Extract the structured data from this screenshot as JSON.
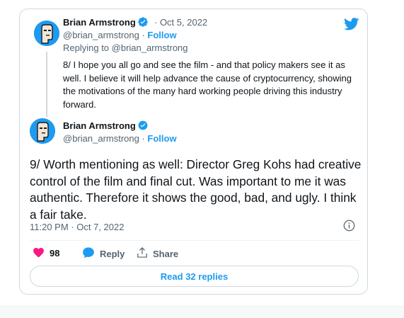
{
  "colors": {
    "accent": "#1d9bf0",
    "heart": "#f91880",
    "text": "#0f1419",
    "muted": "#536471"
  },
  "icons": [
    "twitter-bird-icon",
    "verified-badge-icon",
    "info-icon",
    "heart-icon",
    "reply-bubble-icon",
    "share-icon"
  ],
  "previous_tweet": {
    "author_name": "Brian Armstrong",
    "date": "· Oct 5, 2022",
    "handle": "@brian_armstrong",
    "separator": " · ",
    "follow_label": "Follow",
    "replying_to": "Replying to @brian_armstrong",
    "text": "8/ I hope you all go and see the film - and that policy makers see it as well. I believe it will help advance the cause of cryptocurrency, showing the motivations of the many hard working people driving this industry forward."
  },
  "main_tweet": {
    "author_name": "Brian Armstrong",
    "handle": "@brian_armstrong",
    "separator": " · ",
    "follow_label": "Follow",
    "text": "9/ Worth mentioning as well: Director Greg Kohs had creative control of the film and final cut. Was important to me it was authentic. Therefore it shows the good, bad, and ugly. I think a fair take.",
    "timestamp": "11:20 PM · Oct 7, 2022"
  },
  "actions": {
    "like_count": "98",
    "reply_label": "Reply",
    "share_label": "Share"
  },
  "read_replies_label": "Read 32 replies"
}
